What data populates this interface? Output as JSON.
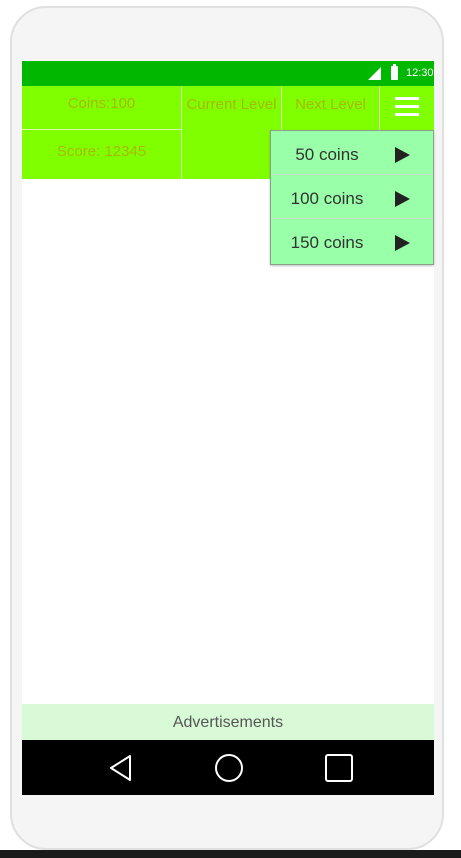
{
  "status_bar": {
    "time": "12:30",
    "signal_icon": "signal-icon",
    "battery_icon": "battery-icon"
  },
  "header": {
    "coins": "Coins:100",
    "score": "Score: 12345",
    "current_level": "Current Level",
    "next_level": "Next Level",
    "menu_icon": "hamburger-menu-icon",
    "settings_icon": "gear-icon"
  },
  "dropdown": {
    "items": [
      {
        "label": "50 coins",
        "icon": "play-arrow-icon"
      },
      {
        "label": "100 coins",
        "icon": "play-arrow-icon"
      },
      {
        "label": "150 coins",
        "icon": "play-arrow-icon"
      }
    ]
  },
  "ads": {
    "label": "Advertisements"
  },
  "nav_bar": {
    "back_icon": "back-icon",
    "home_icon": "home-icon",
    "recents_icon": "recents-icon"
  },
  "colors": {
    "status_bar": "#00b800",
    "header_bg": "#80ff00",
    "header_text": "#a8b800",
    "dropdown_bg": "#99ffa9",
    "ads_bg": "#d9fad6",
    "nav_bg": "#000000"
  }
}
